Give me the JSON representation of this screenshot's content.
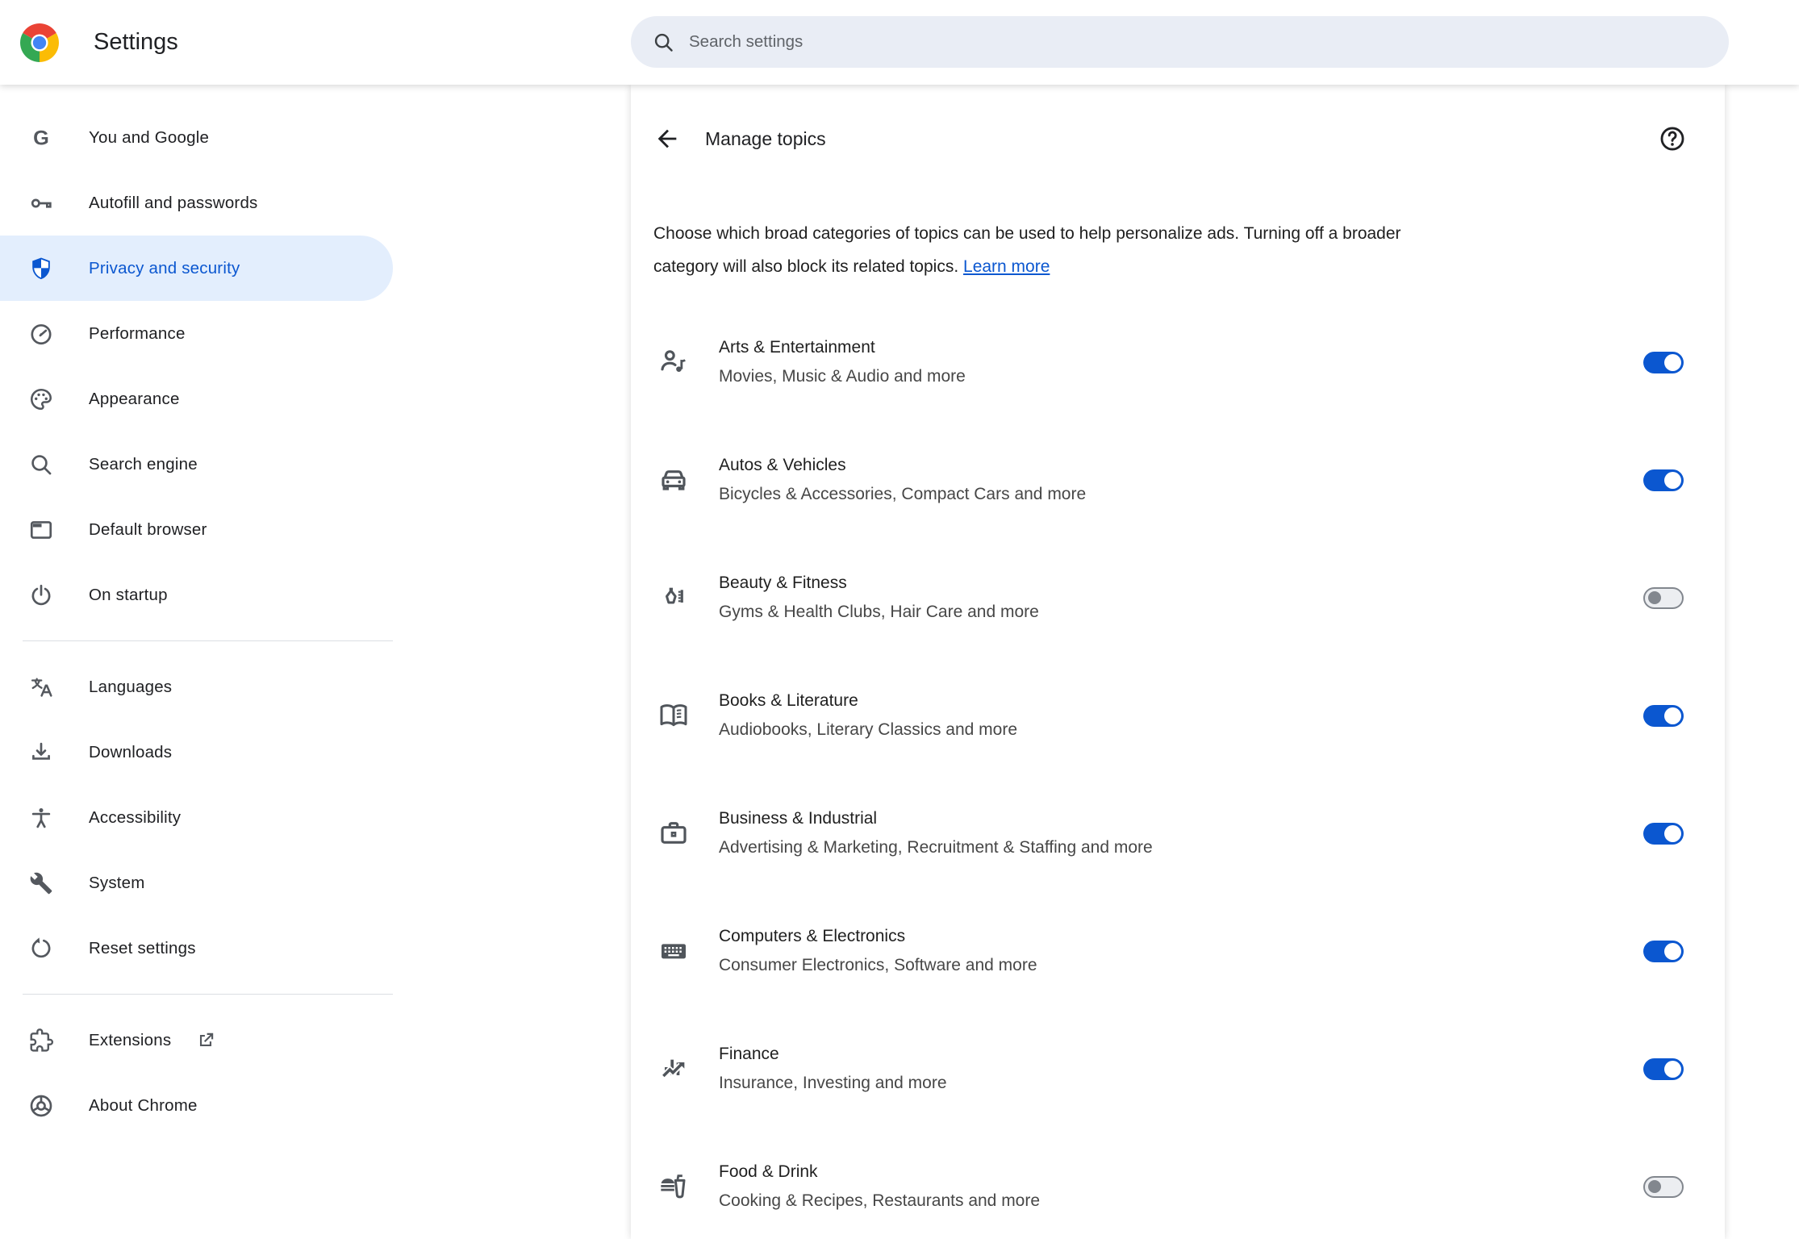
{
  "header": {
    "app_title": "Settings",
    "search_placeholder": "Search settings"
  },
  "sidebar": {
    "sections": [
      [
        {
          "icon": "google-g",
          "label": "You and Google"
        },
        {
          "icon": "key",
          "label": "Autofill and passwords"
        },
        {
          "icon": "shield",
          "label": "Privacy and security",
          "selected": true
        },
        {
          "icon": "speedometer",
          "label": "Performance"
        },
        {
          "icon": "palette",
          "label": "Appearance"
        },
        {
          "icon": "magnifier",
          "label": "Search engine"
        },
        {
          "icon": "browser",
          "label": "Default browser"
        },
        {
          "icon": "power",
          "label": "On startup"
        }
      ],
      [
        {
          "icon": "translate",
          "label": "Languages"
        },
        {
          "icon": "download",
          "label": "Downloads"
        },
        {
          "icon": "accessibility",
          "label": "Accessibility"
        },
        {
          "icon": "wrench",
          "label": "System"
        },
        {
          "icon": "reset",
          "label": "Reset settings"
        }
      ],
      [
        {
          "icon": "puzzle",
          "label": "Extensions",
          "external": true
        },
        {
          "icon": "chrome",
          "label": "About Chrome"
        }
      ]
    ]
  },
  "subpage": {
    "title": "Manage topics",
    "description_line1": "Choose which broad categories of topics can be used to help personalize ads. Turning off a broader",
    "description_line2": "category will also block its related topics.",
    "learn_more_label": "Learn more"
  },
  "topics": [
    {
      "icon": "artist",
      "title": "Arts & Entertainment",
      "subtitle": "Movies, Music & Audio and more",
      "enabled": true
    },
    {
      "icon": "car",
      "title": "Autos & Vehicles",
      "subtitle": "Bicycles & Accessories, Compact Cars and more",
      "enabled": true
    },
    {
      "icon": "beauty",
      "title": "Beauty & Fitness",
      "subtitle": "Gyms & Health Clubs, Hair Care and more",
      "enabled": false
    },
    {
      "icon": "book",
      "title": "Books & Literature",
      "subtitle": "Audiobooks, Literary Classics and more",
      "enabled": true
    },
    {
      "icon": "briefcase",
      "title": "Business & Industrial",
      "subtitle": "Advertising & Marketing, Recruitment & Staffing and more",
      "enabled": true
    },
    {
      "icon": "keyboard",
      "title": "Computers & Electronics",
      "subtitle": "Consumer Electronics, Software and more",
      "enabled": true
    },
    {
      "icon": "finance",
      "title": "Finance",
      "subtitle": "Insurance, Investing and more",
      "enabled": true
    },
    {
      "icon": "fastfood",
      "title": "Food & Drink",
      "subtitle": "Cooking & Recipes, Restaurants and more",
      "enabled": false
    }
  ],
  "colors": {
    "accent": "#0b57d0",
    "selected_bg": "#e3eefd",
    "search_bg": "#e9edf5",
    "title_text": "#202124",
    "secondary_text": "#474747",
    "icon_gray": "#54585e",
    "toggle_off_track": "#eceef1",
    "toggle_off_knob": "#82878e",
    "chrome_red": "#EA4335",
    "chrome_yellow": "#FBBC05",
    "chrome_green": "#34A853",
    "chrome_blue": "#4285F4"
  }
}
